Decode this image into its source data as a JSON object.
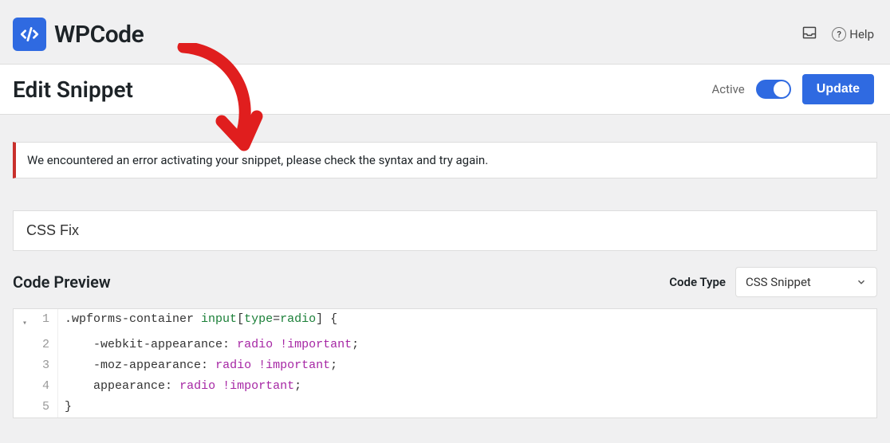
{
  "brand": {
    "name": "WPCode"
  },
  "header": {
    "help_label": "Help"
  },
  "page": {
    "title": "Edit Snippet",
    "active_label": "Active",
    "update_label": "Update"
  },
  "error": {
    "message": "We encountered an error activating your snippet, please check the syntax and try again."
  },
  "snippet": {
    "title": "CSS Fix"
  },
  "preview": {
    "heading": "Code Preview",
    "code_type_label": "Code Type",
    "code_type_value": "CSS Snippet"
  },
  "code_lines": [
    {
      "n": 1,
      "fold": "▾",
      "html": "<span class='tok-sel'>.wpforms-container</span> <span class='tok-tag'>input</span><span class='tok-punc'>[</span><span class='tok-attr'>type</span>=<span class='tok-attr'>radio</span><span class='tok-punc'>]</span> <span class='tok-punc'>{</span>"
    },
    {
      "n": 2,
      "fold": "",
      "html": "    <span class='tok-vendor'>-webkit-</span><span class='tok-prop'>appearance</span><span class='tok-punc'>:</span> <span class='tok-value'>radio</span> <span class='tok-value'>!important</span><span class='tok-punc'>;</span>"
    },
    {
      "n": 3,
      "fold": "",
      "html": "    <span class='tok-vendor'>-moz-</span><span class='tok-prop'>appearance</span><span class='tok-punc'>:</span> <span class='tok-value'>radio</span> <span class='tok-value'>!important</span><span class='tok-punc'>;</span>"
    },
    {
      "n": 4,
      "fold": "",
      "html": "    <span class='tok-prop'>appearance</span><span class='tok-punc'>:</span> <span class='tok-value'>radio</span> <span class='tok-value'>!important</span><span class='tok-punc'>;</span>"
    },
    {
      "n": 5,
      "fold": "",
      "html": "<span class='tok-punc'>}</span>"
    }
  ]
}
